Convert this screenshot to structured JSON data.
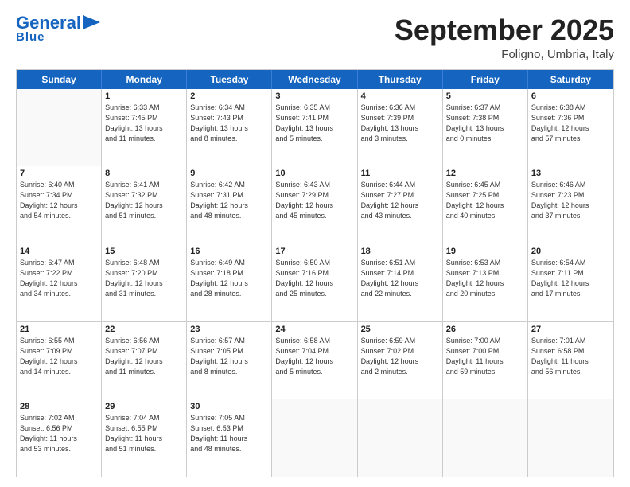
{
  "logo": {
    "general": "General",
    "blue": "Blue"
  },
  "title": "September 2025",
  "location": "Foligno, Umbria, Italy",
  "days": [
    "Sunday",
    "Monday",
    "Tuesday",
    "Wednesday",
    "Thursday",
    "Friday",
    "Saturday"
  ],
  "weeks": [
    [
      {
        "day": "",
        "info": ""
      },
      {
        "day": "1",
        "info": "Sunrise: 6:33 AM\nSunset: 7:45 PM\nDaylight: 13 hours\nand 11 minutes."
      },
      {
        "day": "2",
        "info": "Sunrise: 6:34 AM\nSunset: 7:43 PM\nDaylight: 13 hours\nand 8 minutes."
      },
      {
        "day": "3",
        "info": "Sunrise: 6:35 AM\nSunset: 7:41 PM\nDaylight: 13 hours\nand 5 minutes."
      },
      {
        "day": "4",
        "info": "Sunrise: 6:36 AM\nSunset: 7:39 PM\nDaylight: 13 hours\nand 3 minutes."
      },
      {
        "day": "5",
        "info": "Sunrise: 6:37 AM\nSunset: 7:38 PM\nDaylight: 13 hours\nand 0 minutes."
      },
      {
        "day": "6",
        "info": "Sunrise: 6:38 AM\nSunset: 7:36 PM\nDaylight: 12 hours\nand 57 minutes."
      }
    ],
    [
      {
        "day": "7",
        "info": "Sunrise: 6:40 AM\nSunset: 7:34 PM\nDaylight: 12 hours\nand 54 minutes."
      },
      {
        "day": "8",
        "info": "Sunrise: 6:41 AM\nSunset: 7:32 PM\nDaylight: 12 hours\nand 51 minutes."
      },
      {
        "day": "9",
        "info": "Sunrise: 6:42 AM\nSunset: 7:31 PM\nDaylight: 12 hours\nand 48 minutes."
      },
      {
        "day": "10",
        "info": "Sunrise: 6:43 AM\nSunset: 7:29 PM\nDaylight: 12 hours\nand 45 minutes."
      },
      {
        "day": "11",
        "info": "Sunrise: 6:44 AM\nSunset: 7:27 PM\nDaylight: 12 hours\nand 43 minutes."
      },
      {
        "day": "12",
        "info": "Sunrise: 6:45 AM\nSunset: 7:25 PM\nDaylight: 12 hours\nand 40 minutes."
      },
      {
        "day": "13",
        "info": "Sunrise: 6:46 AM\nSunset: 7:23 PM\nDaylight: 12 hours\nand 37 minutes."
      }
    ],
    [
      {
        "day": "14",
        "info": "Sunrise: 6:47 AM\nSunset: 7:22 PM\nDaylight: 12 hours\nand 34 minutes."
      },
      {
        "day": "15",
        "info": "Sunrise: 6:48 AM\nSunset: 7:20 PM\nDaylight: 12 hours\nand 31 minutes."
      },
      {
        "day": "16",
        "info": "Sunrise: 6:49 AM\nSunset: 7:18 PM\nDaylight: 12 hours\nand 28 minutes."
      },
      {
        "day": "17",
        "info": "Sunrise: 6:50 AM\nSunset: 7:16 PM\nDaylight: 12 hours\nand 25 minutes."
      },
      {
        "day": "18",
        "info": "Sunrise: 6:51 AM\nSunset: 7:14 PM\nDaylight: 12 hours\nand 22 minutes."
      },
      {
        "day": "19",
        "info": "Sunrise: 6:53 AM\nSunset: 7:13 PM\nDaylight: 12 hours\nand 20 minutes."
      },
      {
        "day": "20",
        "info": "Sunrise: 6:54 AM\nSunset: 7:11 PM\nDaylight: 12 hours\nand 17 minutes."
      }
    ],
    [
      {
        "day": "21",
        "info": "Sunrise: 6:55 AM\nSunset: 7:09 PM\nDaylight: 12 hours\nand 14 minutes."
      },
      {
        "day": "22",
        "info": "Sunrise: 6:56 AM\nSunset: 7:07 PM\nDaylight: 12 hours\nand 11 minutes."
      },
      {
        "day": "23",
        "info": "Sunrise: 6:57 AM\nSunset: 7:05 PM\nDaylight: 12 hours\nand 8 minutes."
      },
      {
        "day": "24",
        "info": "Sunrise: 6:58 AM\nSunset: 7:04 PM\nDaylight: 12 hours\nand 5 minutes."
      },
      {
        "day": "25",
        "info": "Sunrise: 6:59 AM\nSunset: 7:02 PM\nDaylight: 12 hours\nand 2 minutes."
      },
      {
        "day": "26",
        "info": "Sunrise: 7:00 AM\nSunset: 7:00 PM\nDaylight: 11 hours\nand 59 minutes."
      },
      {
        "day": "27",
        "info": "Sunrise: 7:01 AM\nSunset: 6:58 PM\nDaylight: 11 hours\nand 56 minutes."
      }
    ],
    [
      {
        "day": "28",
        "info": "Sunrise: 7:02 AM\nSunset: 6:56 PM\nDaylight: 11 hours\nand 53 minutes."
      },
      {
        "day": "29",
        "info": "Sunrise: 7:04 AM\nSunset: 6:55 PM\nDaylight: 11 hours\nand 51 minutes."
      },
      {
        "day": "30",
        "info": "Sunrise: 7:05 AM\nSunset: 6:53 PM\nDaylight: 11 hours\nand 48 minutes."
      },
      {
        "day": "",
        "info": ""
      },
      {
        "day": "",
        "info": ""
      },
      {
        "day": "",
        "info": ""
      },
      {
        "day": "",
        "info": ""
      }
    ]
  ]
}
